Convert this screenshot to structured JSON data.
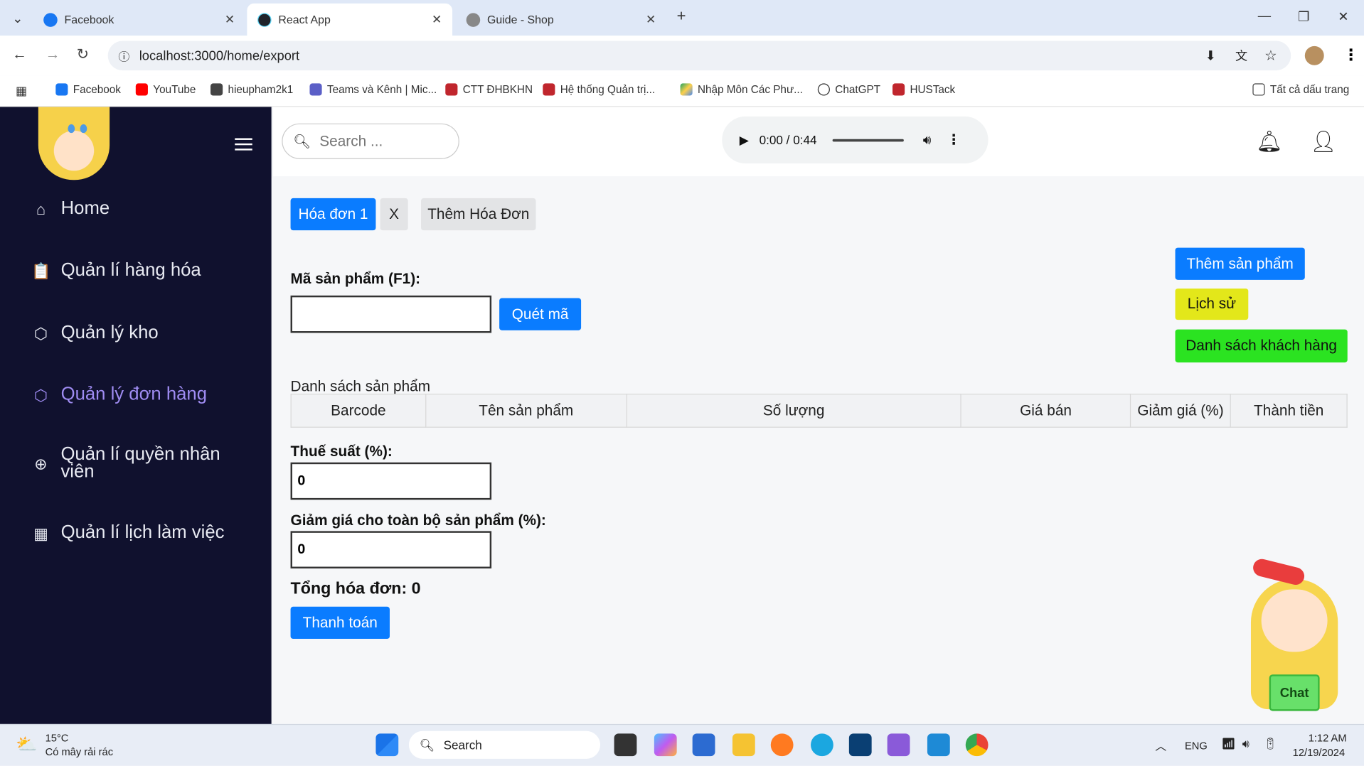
{
  "browser": {
    "tabs": [
      {
        "label": "Facebook",
        "icon": "facebook-icon"
      },
      {
        "label": "React App",
        "icon": "react-icon"
      },
      {
        "label": "Guide - Shop",
        "icon": "globe-icon"
      }
    ],
    "url": "localhost:3000/home/export",
    "bookmarks": [
      "Facebook",
      "YouTube",
      "hieupham2k1",
      "Teams và Kênh | Mic...",
      "CTT ĐHBKHN",
      "Hệ thống Quản trị...",
      "Nhập Môn Các Phư...",
      "ChatGPT",
      "HUSTack"
    ],
    "all_bookmarks": "Tất cả dấu trang"
  },
  "sidebar": {
    "items": [
      {
        "label": "Home",
        "icon": "home-icon"
      },
      {
        "label": "Quản lí hàng hóa",
        "icon": "clipboard-check-icon"
      },
      {
        "label": "Quản lý kho",
        "icon": "box-icon"
      },
      {
        "label": "Quản lý đơn hàng",
        "icon": "box-icon",
        "active": true
      },
      {
        "label": "Quản lí quyền nhân viên",
        "icon": "plus-circle-icon"
      },
      {
        "label": "Quản lí lịch làm việc",
        "icon": "calendar-icon"
      }
    ]
  },
  "topbar": {
    "search_placeholder": "Search ...",
    "player_time": "0:00 / 0:44"
  },
  "main": {
    "invoice_tab": "Hóa đơn 1",
    "close_tab": "X",
    "add_invoice": "Thêm Hóa Đơn",
    "product_code_label": "Mã sản phẩm (F1):",
    "scan_button": "Quét mã",
    "add_product_button": "Thêm sản phẩm",
    "history_button": "Lịch sử",
    "customers_button": "Danh sách khách hàng",
    "product_list_caption": "Danh sách sản phẩm",
    "table_headers": [
      "Barcode",
      "Tên sản phẩm",
      "Số lượng",
      "Giá bán",
      "Giảm giá (%)",
      "Thành tiền"
    ],
    "tax_label": "Thuế suất (%):",
    "tax_value": "0",
    "discount_label": "Giảm giá cho toàn bộ sản phẩm (%):",
    "discount_value": "0",
    "total_label": "Tổng hóa đơn: 0",
    "pay_button": "Thanh toán",
    "chat_button": "Chat"
  },
  "taskbar": {
    "temperature": "15°C",
    "weather": "Có mây rải rác",
    "search": "Search",
    "lang": "ENG",
    "time": "1:12 AM",
    "date": "12/19/2024"
  }
}
